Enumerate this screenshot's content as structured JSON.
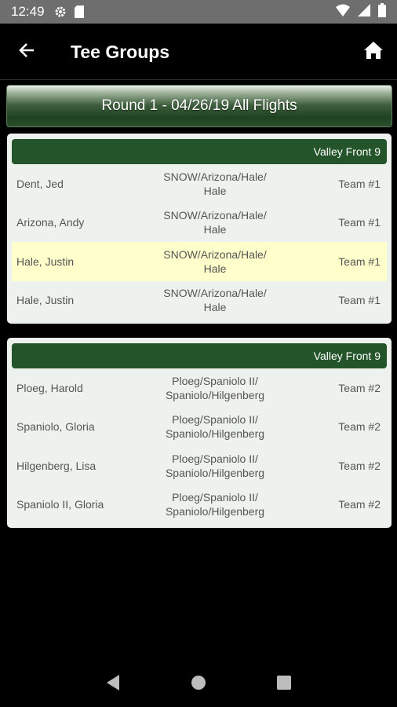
{
  "status_bar": {
    "time": "12:49",
    "icons": [
      "gear-icon",
      "sd-card-icon"
    ],
    "right_icons": [
      "wifi-icon",
      "signal-icon",
      "battery-icon"
    ]
  },
  "app_bar": {
    "title": "Tee Groups",
    "back_icon": "arrow-left-icon",
    "home_icon": "home-icon"
  },
  "round_banner": "Round 1 - 04/26/19 All Flights",
  "groups": [
    {
      "course": "Valley Front 9",
      "rows": [
        {
          "name": "Dent, Jed",
          "group_line1": "SNOW/Arizona/Hale/",
          "group_line2": "Hale",
          "team": "Team #1",
          "highlight": false
        },
        {
          "name": "Arizona, Andy",
          "group_line1": "SNOW/Arizona/Hale/",
          "group_line2": "Hale",
          "team": "Team #1",
          "highlight": false
        },
        {
          "name": "Hale, Justin",
          "group_line1": "SNOW/Arizona/Hale/",
          "group_line2": "Hale",
          "team": "Team #1",
          "highlight": true
        },
        {
          "name": "Hale, Justin",
          "group_line1": "SNOW/Arizona/Hale/",
          "group_line2": "Hale",
          "team": "Team #1",
          "highlight": false
        }
      ]
    },
    {
      "course": "Valley Front 9",
      "rows": [
        {
          "name": "Ploeg, Harold",
          "group_line1": "Ploeg/Spaniolo II/",
          "group_line2": "Spaniolo/Hilgenberg",
          "team": "Team #2",
          "highlight": false
        },
        {
          "name": "Spaniolo, Gloria",
          "group_line1": "Ploeg/Spaniolo II/",
          "group_line2": "Spaniolo/Hilgenberg",
          "team": "Team #2",
          "highlight": false
        },
        {
          "name": "Hilgenberg, Lisa",
          "group_line1": "Ploeg/Spaniolo II/",
          "group_line2": "Spaniolo/Hilgenberg",
          "team": "Team #2",
          "highlight": false
        },
        {
          "name": "Spaniolo II, Gloria",
          "group_line1": "Ploeg/Spaniolo II/",
          "group_line2": "Spaniolo/Hilgenberg",
          "team": "Team #2",
          "highlight": false
        }
      ]
    }
  ],
  "colors": {
    "group_header": "#23542a",
    "highlight_row": "#ffffcc",
    "card_bg": "#eef2ee"
  },
  "nav_bar": [
    "back-triangle-icon",
    "home-circle-icon",
    "recents-square-icon"
  ]
}
